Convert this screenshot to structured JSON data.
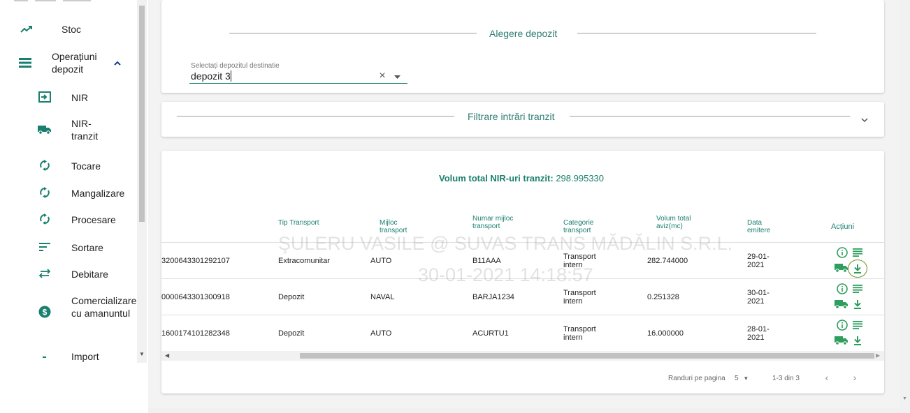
{
  "sidebar": {
    "items": [
      {
        "label": "Stoc",
        "icon": "trending-up-icon"
      },
      {
        "label": "Operațiuni depozit",
        "icon": "list-icon"
      },
      {
        "label": "NIR",
        "icon": "login-box-icon"
      },
      {
        "label": "NIR-tranzit",
        "icon": "truck-icon"
      },
      {
        "label": "Tocare",
        "icon": "refresh-icon"
      },
      {
        "label": "Mangalizare",
        "icon": "refresh-icon"
      },
      {
        "label": "Procesare",
        "icon": "refresh-icon"
      },
      {
        "label": "Sortare",
        "icon": "sort-icon"
      },
      {
        "label": "Debitare",
        "icon": "swap-icon"
      },
      {
        "label": "Comercializare cu amanuntul",
        "icon": "dollar-circle-icon"
      },
      {
        "label": "Import",
        "icon": "square-icon"
      }
    ]
  },
  "depot_card": {
    "title": "Alegere depozit",
    "field_label": "Selectați depozitul destinatie",
    "field_value": "depozit 3"
  },
  "filter_card": {
    "title": "Filtrare intrări tranzit"
  },
  "table_card": {
    "summary_label": "Volum total NIR-uri tranzit:",
    "summary_value": "298.995330",
    "headers": {
      "tip": "Tip Transport",
      "mijloc": "Mijloc transport",
      "numar": "Numar mijloc transport",
      "categorie": "Categorie transport",
      "volum": "Volum total aviz(mc)",
      "data": "Data emitere",
      "actiuni": "Acțiuni"
    },
    "rows": [
      {
        "id": "3200643301292107",
        "tip": "Extracomunitar",
        "mijloc": "AUTO",
        "numar": "B11AAA",
        "categorie": "Transport intern",
        "volum": "282.744000",
        "data": "29-01-2021"
      },
      {
        "id": "0000643301300918",
        "tip": "Depozit",
        "mijloc": "NAVAL",
        "numar": "BARJA1234",
        "categorie": "Transport intern",
        "volum": "0.251328",
        "data": "30-01-2021"
      },
      {
        "id": "1600174101282348",
        "tip": "Depozit",
        "mijloc": "AUTO",
        "numar": "ACURTU1",
        "categorie": "Transport intern",
        "volum": "16.000000",
        "data": "28-01-2021"
      }
    ],
    "watermark_line1": "ŞULERU VASILE @ SUVAS TRANS MĂDĂLIN S.R.L.",
    "watermark_line2": "30-01-2021 14:18:57",
    "pager": {
      "rows_label": "Randuri pe pagina",
      "rows_value": "5",
      "range": "1-3 din 3"
    }
  },
  "colors": {
    "accent": "#1a7f6e",
    "icon_green": "#2e9e5e"
  }
}
